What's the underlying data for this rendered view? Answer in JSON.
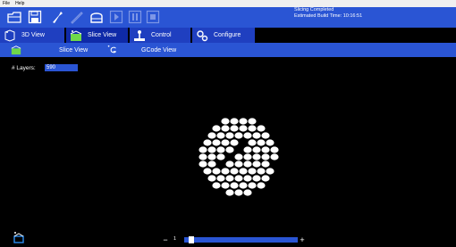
{
  "menu": {
    "file": "File",
    "help": "Help"
  },
  "status": {
    "line1": "Slicing Completed",
    "line2": "Estimated Build Time: 10:16:51"
  },
  "tabs": [
    {
      "label": "3D View",
      "icon": "3d-view-icon"
    },
    {
      "label": "Slice View",
      "icon": "slice-view-icon"
    },
    {
      "label": "Control",
      "icon": "joystick-icon"
    },
    {
      "label": "Configure",
      "icon": "gear-icon"
    }
  ],
  "subtabs": [
    {
      "label": "Slice View",
      "icon": "slice-view-icon"
    },
    {
      "label": "",
      "icon": "gcode-icon"
    },
    {
      "label": "GCode View",
      "icon": ""
    }
  ],
  "layers": {
    "label": "# Layers:",
    "value": "590"
  },
  "slider": {
    "value": "1",
    "minus": "−",
    "plus": "+",
    "position_fraction": 0.005
  },
  "colors": {
    "toolbar": "#2a55d4",
    "tab_active": "#0f2aa8",
    "slice_dots": "#ffffff"
  }
}
